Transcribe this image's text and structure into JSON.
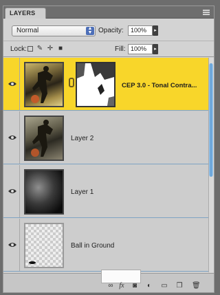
{
  "panel": {
    "tab_label": "LAYERS"
  },
  "controls": {
    "blend_mode": "Normal",
    "opacity_label": "Opacity:",
    "opacity_value": "100%",
    "lock_label": "Lock:",
    "fill_label": "Fill:",
    "fill_value": "100%"
  },
  "layers": [
    {
      "name": "CEP 3.0 - Tonal Contra...",
      "selected": true
    },
    {
      "name": "Layer 2",
      "selected": false
    },
    {
      "name": "Layer 1",
      "selected": false
    },
    {
      "name": "Ball in Ground",
      "selected": false
    }
  ],
  "icons": {
    "panel_menu": "panel-menu-icon",
    "bottom": [
      "link-layers-icon",
      "fx-icon",
      "add-mask-icon",
      "adjustment-layer-icon",
      "new-group-icon",
      "new-layer-icon",
      "trash-icon"
    ]
  },
  "colors": {
    "selected_row": "#f8d62a",
    "scrollbar": "#5d9cd6"
  }
}
